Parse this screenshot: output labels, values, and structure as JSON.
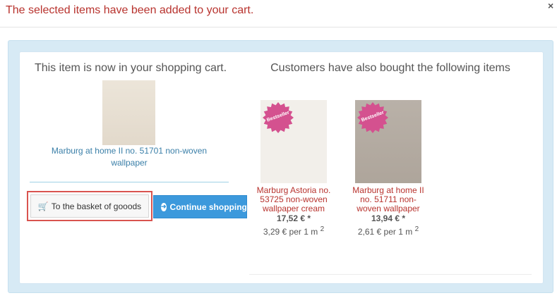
{
  "header": {
    "message": "The selected items have been added to your cart.",
    "close_label": "×"
  },
  "left": {
    "title": "This item is now in your shopping cart.",
    "product_link": "Marburg at home II no. 51701 non-woven wallpaper",
    "basket_button": "To the basket of gooods",
    "basket_icon": "shopping-cart-icon",
    "continue_button": "Continue shopping",
    "continue_icon": "arrow-circle-right-icon"
  },
  "right": {
    "title": "Customers have also bought the following items",
    "items": [
      {
        "badge": "Bestseller",
        "name": "Marburg Astoria no. 53725 non-woven wallpaper cream",
        "price": "17,52 € *",
        "unit_price": "3,29 € per 1 m",
        "unit_sup": "2"
      },
      {
        "badge": "Bestseller",
        "name": "Marburg at home II no. 51711 non-woven wallpaper",
        "price": "13,94 € *",
        "unit_price": "2,61 € per 1 m",
        "unit_sup": "2"
      }
    ]
  },
  "colors": {
    "alert_text": "#b8332e",
    "link_blue": "#3a7fa8",
    "primary_button": "#3c99dc",
    "panel_bg": "#d7eaf5",
    "badge_pink": "#d4518f",
    "highlight_border": "#d9534f"
  }
}
